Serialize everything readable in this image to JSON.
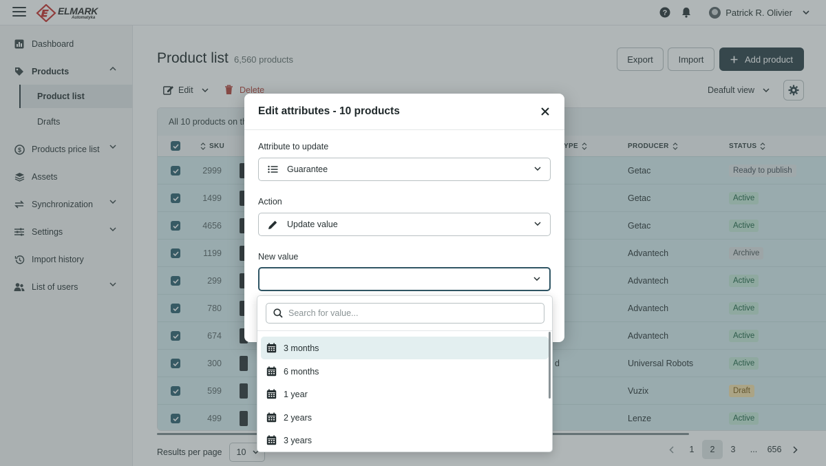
{
  "header": {
    "brand": "ELMARK",
    "brand_sub": "Automatyka",
    "user_name": "Patrick R. Olivier"
  },
  "sidebar": {
    "items": [
      {
        "label": "Dashboard",
        "icon": "dashboard-icon"
      },
      {
        "label": "Products",
        "icon": "tag-icon"
      },
      {
        "label": "Product list"
      },
      {
        "label": "Drafts"
      },
      {
        "label": "Products price list",
        "icon": "price-list-icon"
      },
      {
        "label": "Assets",
        "icon": "layers-icon"
      },
      {
        "label": "Synchronization",
        "icon": "sync-icon"
      },
      {
        "label": "Settings",
        "icon": "settings-sliders-icon"
      },
      {
        "label": "Import history",
        "icon": "history-icon"
      },
      {
        "label": "List of users",
        "icon": "users-icon"
      }
    ]
  },
  "page": {
    "title": "Product list",
    "count": "6,560 products",
    "export_label": "Export",
    "import_label": "Import",
    "add_label": "Add product",
    "edit_label": "Edit",
    "delete_label": "Delete",
    "view_label": "Deafult view"
  },
  "table": {
    "selection_text": "All 10 products on th",
    "columns": {
      "sku": "SKU",
      "type": "YPE",
      "producer": "PRODUCER",
      "status": "STATUS"
    },
    "rows": [
      {
        "sku": "2999",
        "type": "",
        "producer": "Getac",
        "status": "Ready to publish",
        "status_kind": "ready"
      },
      {
        "sku": "1499",
        "type": "",
        "producer": "Getac",
        "status": "Active",
        "status_kind": "active"
      },
      {
        "sku": "4656",
        "type": "",
        "producer": "Getac",
        "status": "Active",
        "status_kind": "active"
      },
      {
        "sku": "1199",
        "type": "",
        "producer": "Advantech",
        "status": "Archive",
        "status_kind": "archive"
      },
      {
        "sku": "299",
        "type": "",
        "producer": "Advantech",
        "status": "Active",
        "status_kind": "active"
      },
      {
        "sku": "780",
        "type": "",
        "producer": "Advantech",
        "status": "Active",
        "status_kind": "active"
      },
      {
        "sku": "674",
        "type": "",
        "producer": "Advantech",
        "status": "Active",
        "status_kind": "active"
      },
      {
        "sku": "300",
        "type": "d",
        "producer": "Universal Robots",
        "status": "Active",
        "status_kind": "active"
      },
      {
        "sku": "599",
        "type": "",
        "producer": "Vuzix",
        "status": "Draft",
        "status_kind": "draft"
      },
      {
        "sku": "499",
        "type": "",
        "producer": "Lenze",
        "status": "Active",
        "status_kind": "active"
      }
    ]
  },
  "footer": {
    "per_page_label": "Results per page",
    "per_page_value": "10",
    "pages": [
      "1",
      "2",
      "3",
      "...",
      "656"
    ],
    "current_page": "2"
  },
  "modal": {
    "title": "Edit attributes - 10 products",
    "attribute_label": "Attribute to update",
    "attribute_value": "Guarantee",
    "action_label": "Action",
    "action_value": "Update value",
    "new_value_label": "New value",
    "new_value": ""
  },
  "dropdown": {
    "search_placeholder": "Search for value...",
    "options": [
      "3 months",
      "6 months",
      "1 year",
      "2 years",
      "3 years"
    ],
    "highlighted": "3 months"
  },
  "colors": {
    "primary": "#2e4148",
    "row_selected": "#d7ecef",
    "delete": "#b6443c",
    "active_badge": "#c7e9d8",
    "draft_badge": "#f6e0aa"
  }
}
